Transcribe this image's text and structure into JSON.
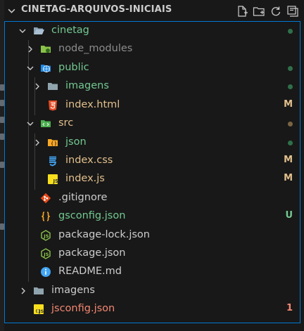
{
  "explorer": {
    "title": "CINETAG-ARQUIVOS-INICIAIS",
    "actions": [
      {
        "name": "new-file-icon"
      },
      {
        "name": "new-folder-icon"
      },
      {
        "name": "refresh-icon"
      },
      {
        "name": "collapse-all-icon"
      }
    ]
  },
  "tree": [
    {
      "label": "cinetag",
      "badge": "",
      "color": "#73c991",
      "dot": "#2f6f4a"
    },
    {
      "label": "node_modules",
      "badge": "",
      "color": "#8c8c8c",
      "dot": ""
    },
    {
      "label": "public",
      "badge": "",
      "color": "#73c991",
      "dot": "#2f6f4a"
    },
    {
      "label": "imagens",
      "badge": "",
      "color": "#73c991",
      "dot": "#2f6f4a"
    },
    {
      "label": "index.html",
      "badge": "M",
      "color": "#e2c08d",
      "dot": ""
    },
    {
      "label": "src",
      "badge": "",
      "color": "#e2c08d",
      "dot": "#7a6542"
    },
    {
      "label": "json",
      "badge": "",
      "color": "#73c991",
      "dot": "#2f6f4a"
    },
    {
      "label": "index.css",
      "badge": "M",
      "color": "#e2c08d",
      "dot": ""
    },
    {
      "label": "index.js",
      "badge": "M",
      "color": "#e2c08d",
      "dot": ""
    },
    {
      "label": ".gitignore",
      "badge": "",
      "color": "#cccccc",
      "dot": ""
    },
    {
      "label": "gsconfig.json",
      "badge": "U",
      "color": "#73c991",
      "dot": ""
    },
    {
      "label": "package-lock.json",
      "badge": "",
      "color": "#cccccc",
      "dot": ""
    },
    {
      "label": "package.json",
      "badge": "",
      "color": "#cccccc",
      "dot": ""
    },
    {
      "label": "README.md",
      "badge": "",
      "color": "#cccccc",
      "dot": ""
    },
    {
      "label": "imagens",
      "badge": "",
      "color": "#cccccc",
      "dot": ""
    },
    {
      "label": "jsconfig.json",
      "badge": "1",
      "color": "#f48771",
      "dot": ""
    }
  ],
  "colors": {
    "accent": "#0078d4",
    "modified": "#e2c08d",
    "untracked": "#73c991",
    "error": "#f48771"
  }
}
